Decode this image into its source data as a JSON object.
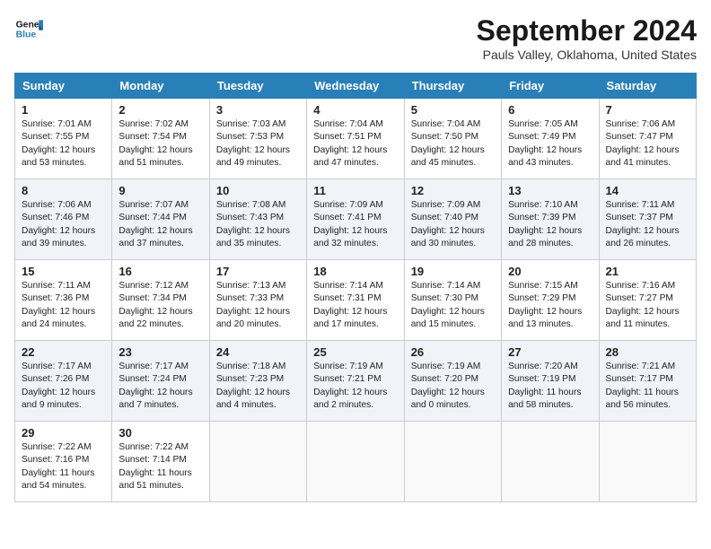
{
  "header": {
    "logo_line1": "General",
    "logo_line2": "Blue",
    "month_title": "September 2024",
    "location": "Pauls Valley, Oklahoma, United States"
  },
  "weekdays": [
    "Sunday",
    "Monday",
    "Tuesday",
    "Wednesday",
    "Thursday",
    "Friday",
    "Saturday"
  ],
  "weeks": [
    [
      {
        "day": "1",
        "sunrise": "Sunrise: 7:01 AM",
        "sunset": "Sunset: 7:55 PM",
        "daylight": "Daylight: 12 hours and 53 minutes."
      },
      {
        "day": "2",
        "sunrise": "Sunrise: 7:02 AM",
        "sunset": "Sunset: 7:54 PM",
        "daylight": "Daylight: 12 hours and 51 minutes."
      },
      {
        "day": "3",
        "sunrise": "Sunrise: 7:03 AM",
        "sunset": "Sunset: 7:53 PM",
        "daylight": "Daylight: 12 hours and 49 minutes."
      },
      {
        "day": "4",
        "sunrise": "Sunrise: 7:04 AM",
        "sunset": "Sunset: 7:51 PM",
        "daylight": "Daylight: 12 hours and 47 minutes."
      },
      {
        "day": "5",
        "sunrise": "Sunrise: 7:04 AM",
        "sunset": "Sunset: 7:50 PM",
        "daylight": "Daylight: 12 hours and 45 minutes."
      },
      {
        "day": "6",
        "sunrise": "Sunrise: 7:05 AM",
        "sunset": "Sunset: 7:49 PM",
        "daylight": "Daylight: 12 hours and 43 minutes."
      },
      {
        "day": "7",
        "sunrise": "Sunrise: 7:06 AM",
        "sunset": "Sunset: 7:47 PM",
        "daylight": "Daylight: 12 hours and 41 minutes."
      }
    ],
    [
      {
        "day": "8",
        "sunrise": "Sunrise: 7:06 AM",
        "sunset": "Sunset: 7:46 PM",
        "daylight": "Daylight: 12 hours and 39 minutes."
      },
      {
        "day": "9",
        "sunrise": "Sunrise: 7:07 AM",
        "sunset": "Sunset: 7:44 PM",
        "daylight": "Daylight: 12 hours and 37 minutes."
      },
      {
        "day": "10",
        "sunrise": "Sunrise: 7:08 AM",
        "sunset": "Sunset: 7:43 PM",
        "daylight": "Daylight: 12 hours and 35 minutes."
      },
      {
        "day": "11",
        "sunrise": "Sunrise: 7:09 AM",
        "sunset": "Sunset: 7:41 PM",
        "daylight": "Daylight: 12 hours and 32 minutes."
      },
      {
        "day": "12",
        "sunrise": "Sunrise: 7:09 AM",
        "sunset": "Sunset: 7:40 PM",
        "daylight": "Daylight: 12 hours and 30 minutes."
      },
      {
        "day": "13",
        "sunrise": "Sunrise: 7:10 AM",
        "sunset": "Sunset: 7:39 PM",
        "daylight": "Daylight: 12 hours and 28 minutes."
      },
      {
        "day": "14",
        "sunrise": "Sunrise: 7:11 AM",
        "sunset": "Sunset: 7:37 PM",
        "daylight": "Daylight: 12 hours and 26 minutes."
      }
    ],
    [
      {
        "day": "15",
        "sunrise": "Sunrise: 7:11 AM",
        "sunset": "Sunset: 7:36 PM",
        "daylight": "Daylight: 12 hours and 24 minutes."
      },
      {
        "day": "16",
        "sunrise": "Sunrise: 7:12 AM",
        "sunset": "Sunset: 7:34 PM",
        "daylight": "Daylight: 12 hours and 22 minutes."
      },
      {
        "day": "17",
        "sunrise": "Sunrise: 7:13 AM",
        "sunset": "Sunset: 7:33 PM",
        "daylight": "Daylight: 12 hours and 20 minutes."
      },
      {
        "day": "18",
        "sunrise": "Sunrise: 7:14 AM",
        "sunset": "Sunset: 7:31 PM",
        "daylight": "Daylight: 12 hours and 17 minutes."
      },
      {
        "day": "19",
        "sunrise": "Sunrise: 7:14 AM",
        "sunset": "Sunset: 7:30 PM",
        "daylight": "Daylight: 12 hours and 15 minutes."
      },
      {
        "day": "20",
        "sunrise": "Sunrise: 7:15 AM",
        "sunset": "Sunset: 7:29 PM",
        "daylight": "Daylight: 12 hours and 13 minutes."
      },
      {
        "day": "21",
        "sunrise": "Sunrise: 7:16 AM",
        "sunset": "Sunset: 7:27 PM",
        "daylight": "Daylight: 12 hours and 11 minutes."
      }
    ],
    [
      {
        "day": "22",
        "sunrise": "Sunrise: 7:17 AM",
        "sunset": "Sunset: 7:26 PM",
        "daylight": "Daylight: 12 hours and 9 minutes."
      },
      {
        "day": "23",
        "sunrise": "Sunrise: 7:17 AM",
        "sunset": "Sunset: 7:24 PM",
        "daylight": "Daylight: 12 hours and 7 minutes."
      },
      {
        "day": "24",
        "sunrise": "Sunrise: 7:18 AM",
        "sunset": "Sunset: 7:23 PM",
        "daylight": "Daylight: 12 hours and 4 minutes."
      },
      {
        "day": "25",
        "sunrise": "Sunrise: 7:19 AM",
        "sunset": "Sunset: 7:21 PM",
        "daylight": "Daylight: 12 hours and 2 minutes."
      },
      {
        "day": "26",
        "sunrise": "Sunrise: 7:19 AM",
        "sunset": "Sunset: 7:20 PM",
        "daylight": "Daylight: 12 hours and 0 minutes."
      },
      {
        "day": "27",
        "sunrise": "Sunrise: 7:20 AM",
        "sunset": "Sunset: 7:19 PM",
        "daylight": "Daylight: 11 hours and 58 minutes."
      },
      {
        "day": "28",
        "sunrise": "Sunrise: 7:21 AM",
        "sunset": "Sunset: 7:17 PM",
        "daylight": "Daylight: 11 hours and 56 minutes."
      }
    ],
    [
      {
        "day": "29",
        "sunrise": "Sunrise: 7:22 AM",
        "sunset": "Sunset: 7:16 PM",
        "daylight": "Daylight: 11 hours and 54 minutes."
      },
      {
        "day": "30",
        "sunrise": "Sunrise: 7:22 AM",
        "sunset": "Sunset: 7:14 PM",
        "daylight": "Daylight: 11 hours and 51 minutes."
      },
      null,
      null,
      null,
      null,
      null
    ]
  ]
}
